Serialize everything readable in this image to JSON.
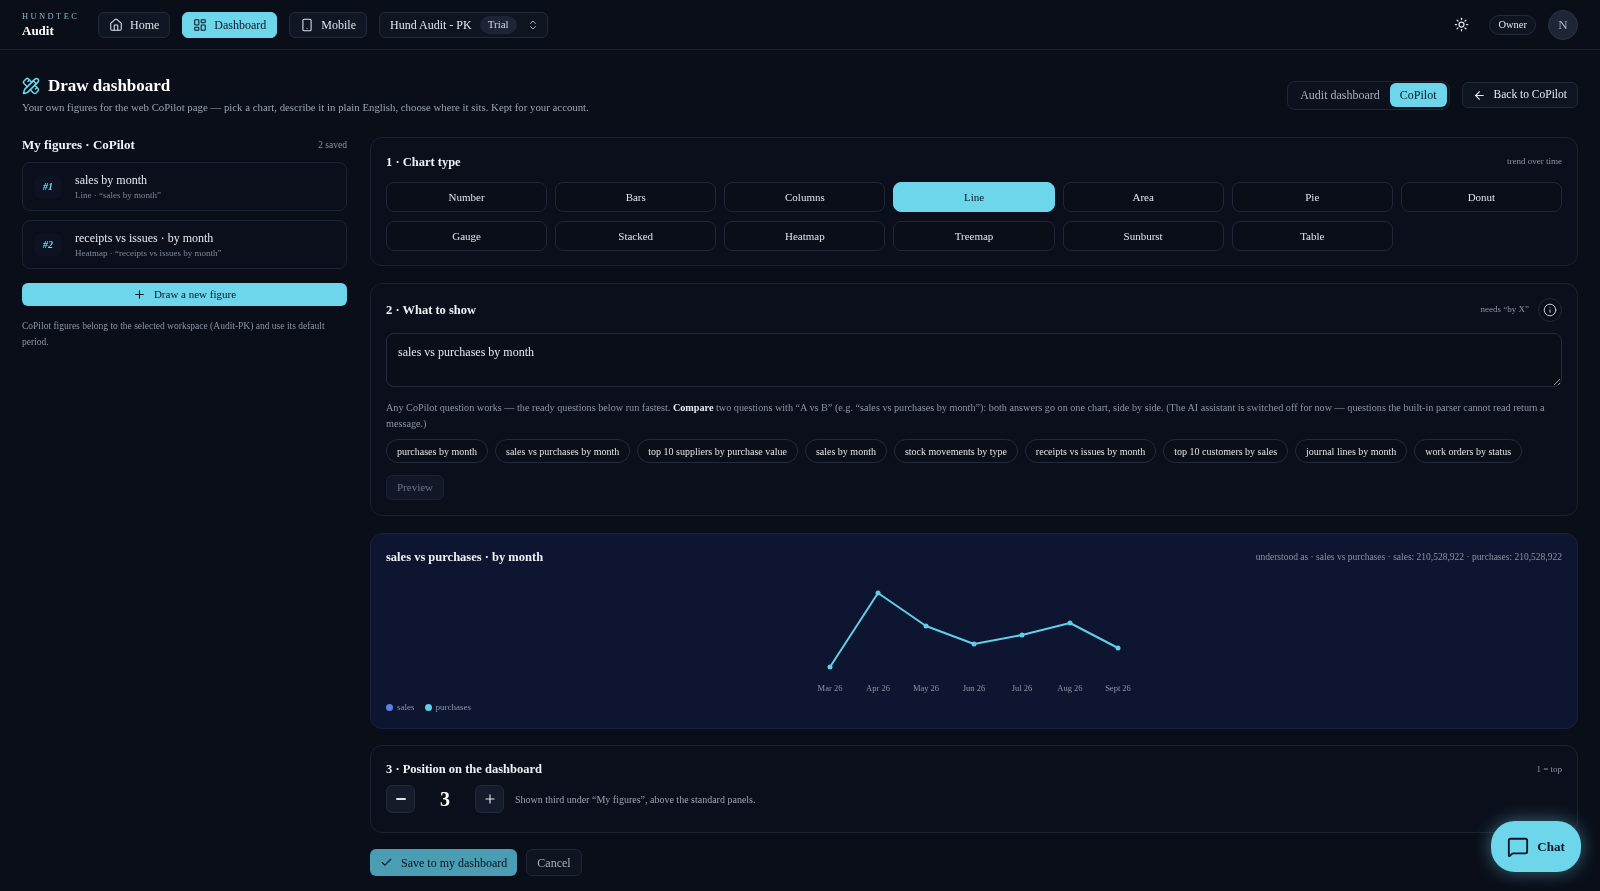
{
  "top_bar": {
    "brand": {
      "kicker": "HUNDTEC",
      "name": "Audit"
    },
    "nav": [
      {
        "label": "Home",
        "selected": false
      },
      {
        "label": "Dashboard",
        "selected": true
      },
      {
        "label": "Mobile",
        "selected": false
      }
    ],
    "workspace": {
      "name": "Hund Audit - PK",
      "badge": "Trial"
    },
    "role": "Owner",
    "avatar": "N"
  },
  "header": {
    "title": "Draw dashboard",
    "subtitle": "Your own figures for the web CoPilot page — pick a chart, describe it in plain English, choose where it sits. Kept for your account.",
    "view_toggle": [
      {
        "label": "Audit dashboard",
        "selected": false
      },
      {
        "label": "CoPilot",
        "selected": true
      }
    ],
    "back_button": "Back to CoPilot"
  },
  "sidebar": {
    "title": "My figures · CoPilot",
    "count": "2 saved",
    "figures": [
      {
        "number": "#1",
        "title": "sales by month",
        "detail": "Line · “sales by month”"
      },
      {
        "number": "#2",
        "title": "receipts vs issues · by month",
        "detail": "Heatmap · “receipts vs issues by month”"
      }
    ],
    "new_button": "Draw a new figure",
    "note": "CoPilot figures belong to the selected workspace (Audit-PK) and use its default period."
  },
  "chart_type": {
    "title": "1 · Chart type",
    "hint": "trend over time",
    "options": [
      {
        "label": "Number",
        "selected": false
      },
      {
        "label": "Bars",
        "selected": false
      },
      {
        "label": "Columns",
        "selected": false
      },
      {
        "label": "Line",
        "selected": true
      },
      {
        "label": "Area",
        "selected": false
      },
      {
        "label": "Pie",
        "selected": false
      },
      {
        "label": "Donut",
        "selected": false
      },
      {
        "label": "Gauge",
        "selected": false
      },
      {
        "label": "Stacked",
        "selected": false
      },
      {
        "label": "Heatmap",
        "selected": false
      },
      {
        "label": "Treemap",
        "selected": false
      },
      {
        "label": "Sunburst",
        "selected": false
      },
      {
        "label": "Table",
        "selected": false
      }
    ]
  },
  "what_to_show": {
    "title": "2 · What to show",
    "hint": "needs “by X”",
    "query": "sales vs purchases by month",
    "help": "Any CoPilot question works — the ready questions below run fastest. **Compare** two questions with “A vs B” (e.g. “sales vs purchases by month”): both answers go on one chart, side by side. (The AI assistant is switched off for now — questions the built-in parser cannot read return a message.)",
    "suggestions": [
      "purchases by month",
      "sales vs purchases by month",
      "top 10 suppliers by purchase value",
      "sales by month",
      "stock movements by type",
      "receipts vs issues by month",
      "top 10 customers by sales",
      "journal lines by month",
      "work orders by status"
    ],
    "preview_button": {
      "label": "Preview",
      "disabled": true
    }
  },
  "preview": {
    "title": "sales vs purchases · by month",
    "summary": "understood as · sales vs purchases · sales: 210,528,922 · purchases: 210,528,922",
    "x_labels": [
      "Mar 26",
      "Apr 26",
      "May 26",
      "Jun 26",
      "Jul 26",
      "Aug 26",
      "Sept 26"
    ],
    "legend": [
      {
        "name": "sales",
        "color": "#5b80e6"
      },
      {
        "name": "purchases",
        "color": "#62cfe8"
      }
    ]
  },
  "position": {
    "title": "3 · Position on the dashboard",
    "hint": "1 = top",
    "value": "3",
    "note": "Shown third under “My figures”, above the standard panels."
  },
  "actions": {
    "save": "Save to my dashboard",
    "cancel": "Cancel"
  },
  "chat_button": "Chat"
}
